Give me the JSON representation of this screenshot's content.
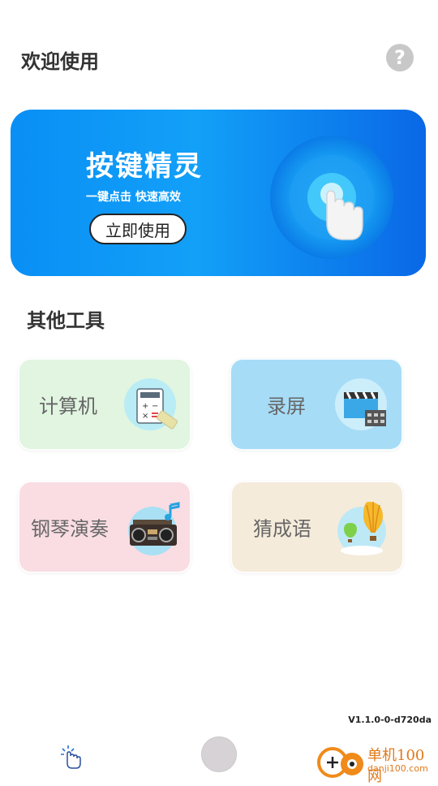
{
  "header": {
    "title": "欢迎使用",
    "help_icon": "question-icon",
    "help_symbol": "?"
  },
  "banner": {
    "title": "按键精灵",
    "subtitle": "一键点击 快速高效",
    "button_label": "立即使用",
    "art_icon": "tap-hand-icon"
  },
  "section": {
    "title": "其他工具"
  },
  "tools": [
    {
      "label": "计算机",
      "icon": "calculator-icon",
      "color": "#e1f5e1"
    },
    {
      "label": "录屏",
      "icon": "video-clapper-icon",
      "color": "#a7dcf7"
    },
    {
      "label": "钢琴演奏",
      "icon": "radio-music-icon",
      "color": "#f9dde3"
    },
    {
      "label": "猜成语",
      "icon": "hot-air-balloon-icon",
      "color": "#f5ebdb"
    }
  ],
  "footer": {
    "version": "V1.1.0-0-d720da",
    "left_icon": "tap-sparkle-icon",
    "home_icon": "home-circle-icon"
  },
  "watermark": {
    "line1": "单机100网",
    "line2": "danji100.com"
  }
}
